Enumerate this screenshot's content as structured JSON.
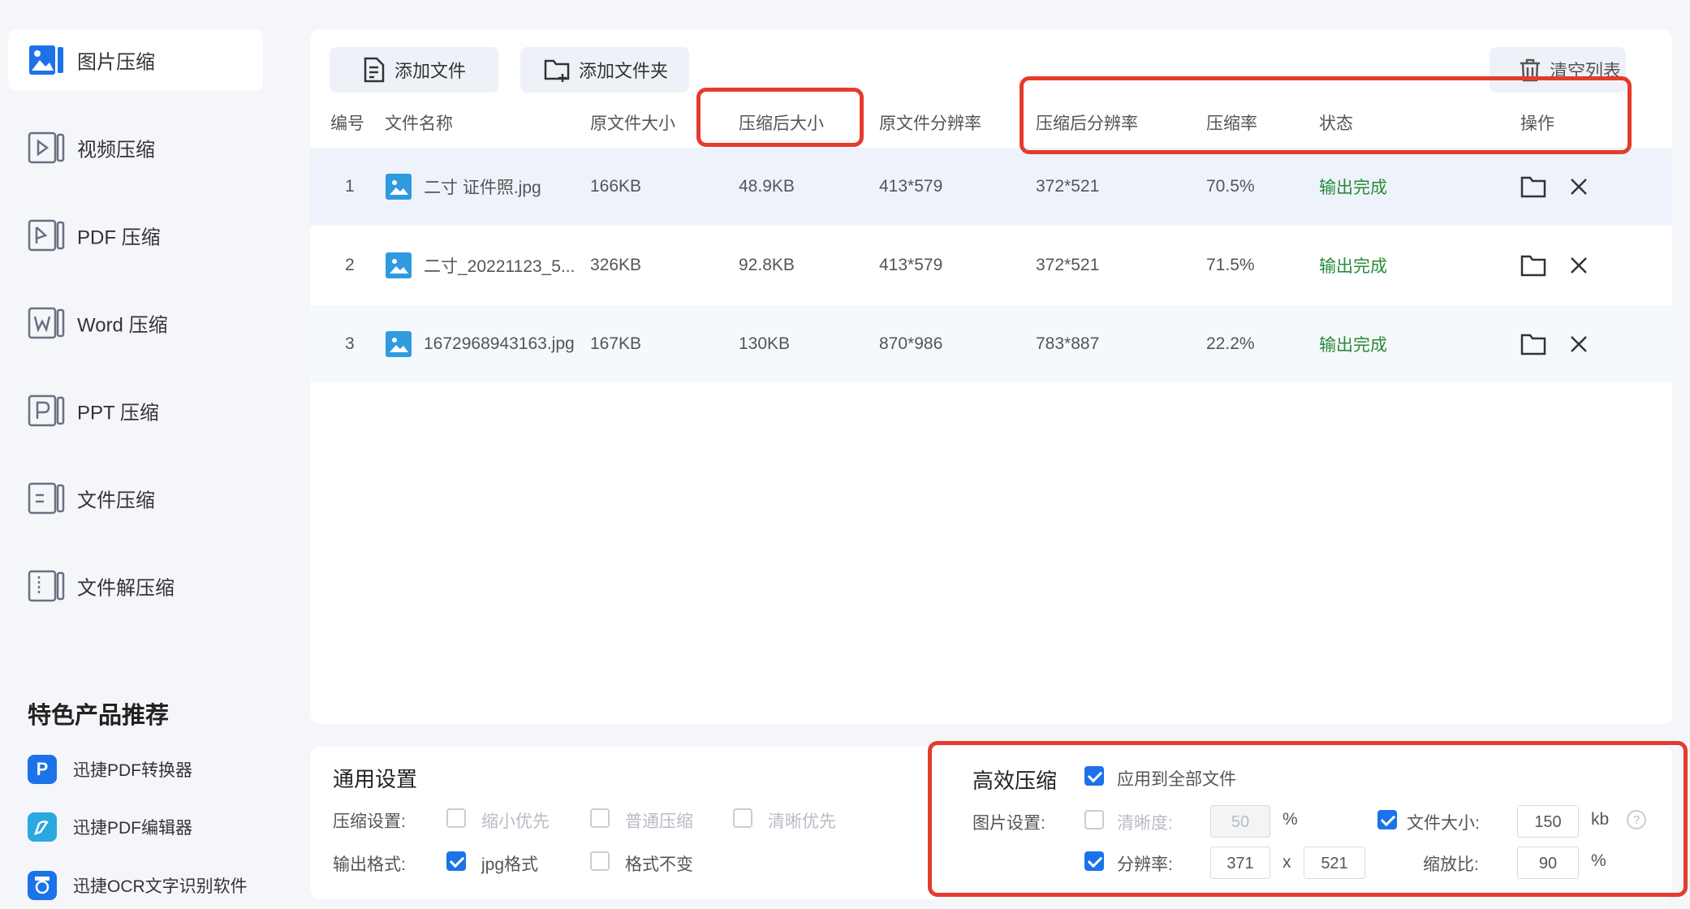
{
  "sidebar": {
    "items": [
      {
        "label": "图片压缩",
        "icon": "image-compress-icon",
        "active": true
      },
      {
        "label": "视频压缩",
        "icon": "video-compress-icon"
      },
      {
        "label": "PDF 压缩",
        "icon": "pdf-compress-icon"
      },
      {
        "label": "Word 压缩",
        "icon": "word-compress-icon"
      },
      {
        "label": "PPT 压缩",
        "icon": "ppt-compress-icon"
      },
      {
        "label": "文件压缩",
        "icon": "file-compress-icon"
      },
      {
        "label": "文件解压缩",
        "icon": "file-decompress-icon"
      }
    ],
    "featured_title": "特色产品推荐",
    "products": [
      {
        "label": "迅捷PDF转换器",
        "icon": "pdf-converter-icon",
        "color": "#1c72e8"
      },
      {
        "label": "迅捷PDF编辑器",
        "icon": "pdf-editor-icon",
        "color": "#2aa8e0"
      },
      {
        "label": "迅捷OCR文字识别软件",
        "icon": "ocr-icon",
        "color": "#1c72e8"
      }
    ]
  },
  "toolbar": {
    "add_file": "添加文件",
    "add_folder": "添加文件夹",
    "clear_list": "清空列表"
  },
  "table": {
    "headers": [
      "编号",
      "文件名称",
      "原文件大小",
      "压缩后大小",
      "原文件分辨率",
      "压缩后分辨率",
      "压缩率",
      "状态",
      "操作"
    ],
    "rows": [
      {
        "no": "1",
        "name": "二寸 证件照.jpg",
        "orig_size": "166KB",
        "new_size": "48.9KB",
        "orig_res": "413*579",
        "new_res": "372*521",
        "ratio": "70.5%",
        "status": "输出完成"
      },
      {
        "no": "2",
        "name": "二寸_20221123_5...",
        "orig_size": "326KB",
        "new_size": "92.8KB",
        "orig_res": "413*579",
        "new_res": "372*521",
        "ratio": "71.5%",
        "status": "输出完成"
      },
      {
        "no": "3",
        "name": "1672968943163.jpg",
        "orig_size": "167KB",
        "new_size": "130KB",
        "orig_res": "870*986",
        "new_res": "783*887",
        "ratio": "22.2%",
        "status": "输出完成"
      }
    ]
  },
  "general_settings": {
    "title": "通用设置",
    "compress_label": "压缩设置:",
    "compress_options": [
      "缩小优先",
      "普通压缩",
      "清晰优先"
    ],
    "format_label": "输出格式:",
    "format_options": [
      {
        "label": "jpg格式",
        "checked": true
      },
      {
        "label": "格式不变",
        "checked": false
      }
    ]
  },
  "efficient": {
    "title": "高效压缩",
    "apply_all": "应用到全部文件",
    "apply_all_checked": true,
    "image_settings_label": "图片设置:",
    "clarity_label": "清晰度:",
    "clarity_checked": false,
    "clarity_value": "50",
    "clarity_unit": "%",
    "filesize_label": "文件大小:",
    "filesize_checked": true,
    "filesize_value": "150",
    "filesize_unit": "kb",
    "help_icon": "?",
    "resolution_label": "分辨率:",
    "resolution_checked": true,
    "res_w": "371",
    "res_x": "x",
    "res_h": "521",
    "scale_label": "缩放比:",
    "scale_value": "90",
    "scale_unit": "%"
  },
  "colors": {
    "accent": "#1c72e8",
    "status_green": "#2a8a3a",
    "annotation_red": "#e53b2c"
  }
}
